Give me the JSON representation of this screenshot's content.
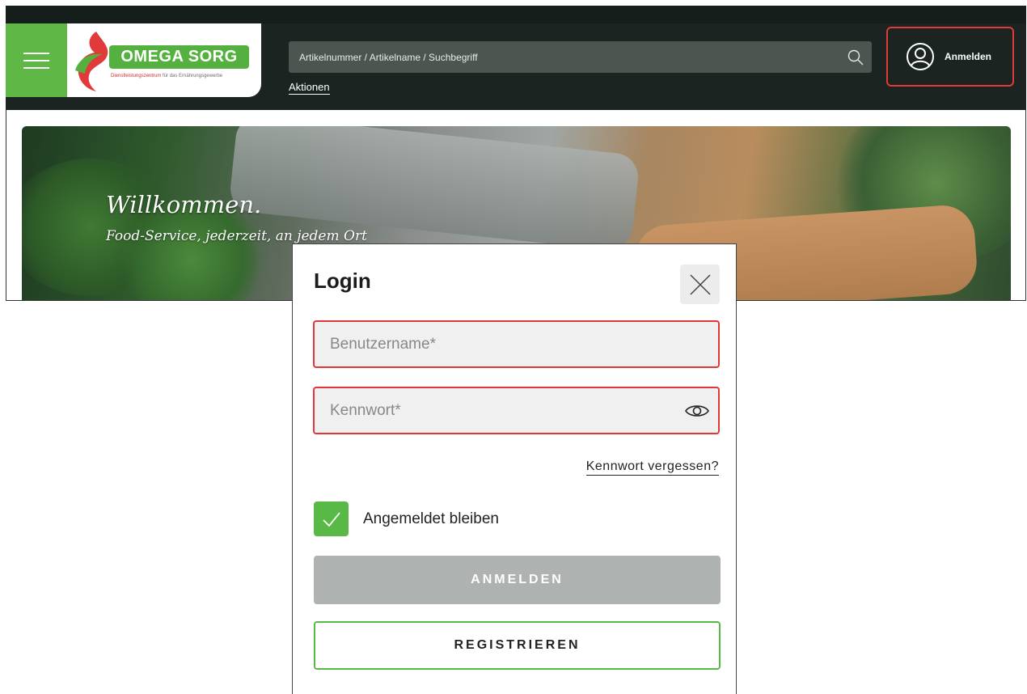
{
  "header": {
    "brand_name": "OMEGA SORG",
    "brand_tagline_red": "Dienstleistungszentrum",
    "brand_tagline_grey": "für das Ernährungsgewerbe",
    "search_placeholder": "Artikelnummer / Artikelname / Suchbegriff",
    "nav_link": "Aktionen",
    "login_label": "Anmelden"
  },
  "hero": {
    "title": "Willkommen.",
    "subtitle": "Food-Service, jederzeit, an jedem Ort"
  },
  "login_modal": {
    "title": "Login",
    "username_placeholder": "Benutzername*",
    "password_placeholder": "Kennwort*",
    "forgot_password": "Kennwort vergessen?",
    "stay_logged_in": "Angemeldet bleiben",
    "stay_logged_in_checked": true,
    "login_button": "ANMELDEN",
    "register_button": "REGISTRIEREN"
  },
  "colors": {
    "brand_green": "#58b947",
    "brand_red": "#e0383a",
    "header_dark": "#1b2420",
    "button_disabled": "#aeb2b0"
  }
}
